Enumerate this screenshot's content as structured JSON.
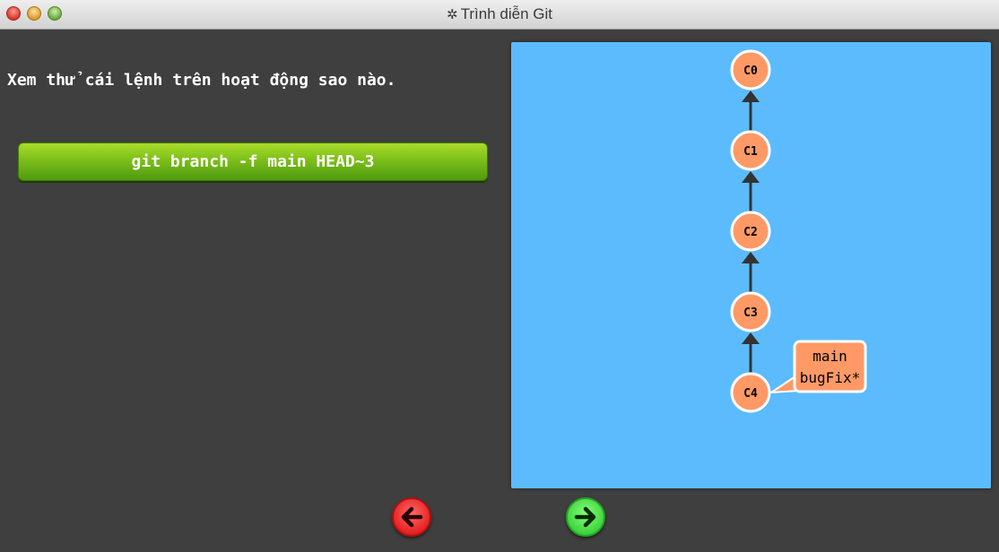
{
  "window": {
    "title": "Trình diễn Git",
    "title_icon": "gear-icon"
  },
  "instruction": {
    "text": "Xem thử cái lệnh trên hoạt động sao nào."
  },
  "command_button": {
    "label": "git branch -f main HEAD~3"
  },
  "tree": {
    "commits": [
      {
        "id": "C0",
        "parent": null
      },
      {
        "id": "C1",
        "parent": "C0"
      },
      {
        "id": "C2",
        "parent": "C1"
      },
      {
        "id": "C3",
        "parent": "C2"
      },
      {
        "id": "C4",
        "parent": "C3"
      }
    ],
    "branch_tag": {
      "target": "C4",
      "lines": [
        "main",
        "bugFix*"
      ]
    }
  },
  "nav": {
    "back_icon": "arrow-left-icon",
    "next_icon": "arrow-right-icon"
  },
  "colors": {
    "background": "#3f3f3f",
    "viz_background": "#5cbbfc",
    "commit_fill": "#ff9966",
    "edge": "#333333",
    "command_button": "#7cbf1a",
    "back_button": "#e41c1c",
    "next_button": "#3ad13a"
  }
}
